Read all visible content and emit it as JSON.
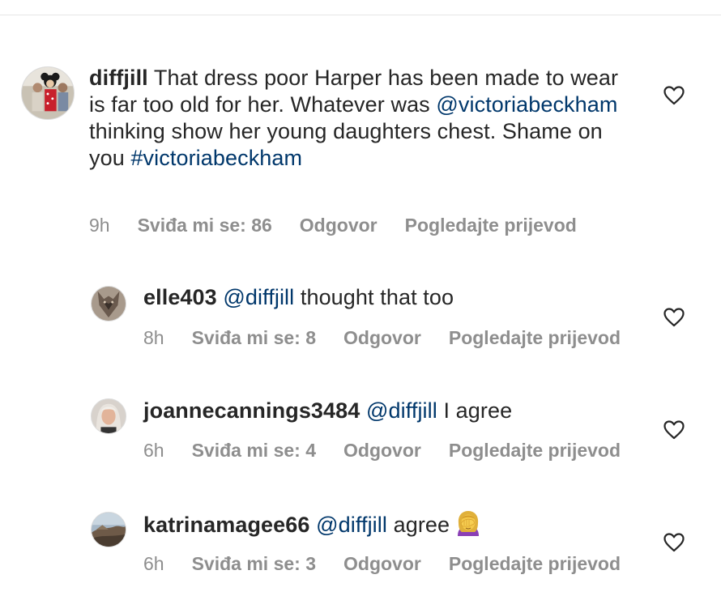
{
  "comments": [
    {
      "username": "diffjill",
      "text_part1": " That dress poor Harper has been made to wear is far too old for her. Whatever was ",
      "mention": "@victoriabeckham",
      "text_part2": " thinking show her young daughters chest. Shame on you ",
      "hashtag": "#victoriabeckham",
      "time": "9h",
      "likes": "Sviđa mi se: 86",
      "reply": "Odgovor",
      "translate": "Pogledajte prijevod"
    },
    {
      "username": "elle403",
      "mention": "@diffjill",
      "text": " thought that too",
      "time": "8h",
      "likes": "Sviđa mi se: 8",
      "reply": "Odgovor",
      "translate": "Pogledajte prijevod"
    },
    {
      "username": "joannecannings3484",
      "mention": "@diffjill",
      "text": " I agree",
      "time": "6h",
      "likes": "Sviđa mi se: 4",
      "reply": "Odgovor",
      "translate": "Pogledajte prijevod"
    },
    {
      "username": "katrinamagee66",
      "mention": "@diffjill",
      "text": " agree",
      "emoji": "facepalm-woman-emoji",
      "time": "6h",
      "likes": "Sviđa mi se: 3",
      "reply": "Odgovor",
      "translate": "Pogledajte prijevod"
    }
  ],
  "colors": {
    "text": "#262626",
    "secondary": "#8e8e8e",
    "link": "#00376b",
    "divider": "#e6e6e6"
  },
  "icons": [
    "heart-outline-icon"
  ]
}
